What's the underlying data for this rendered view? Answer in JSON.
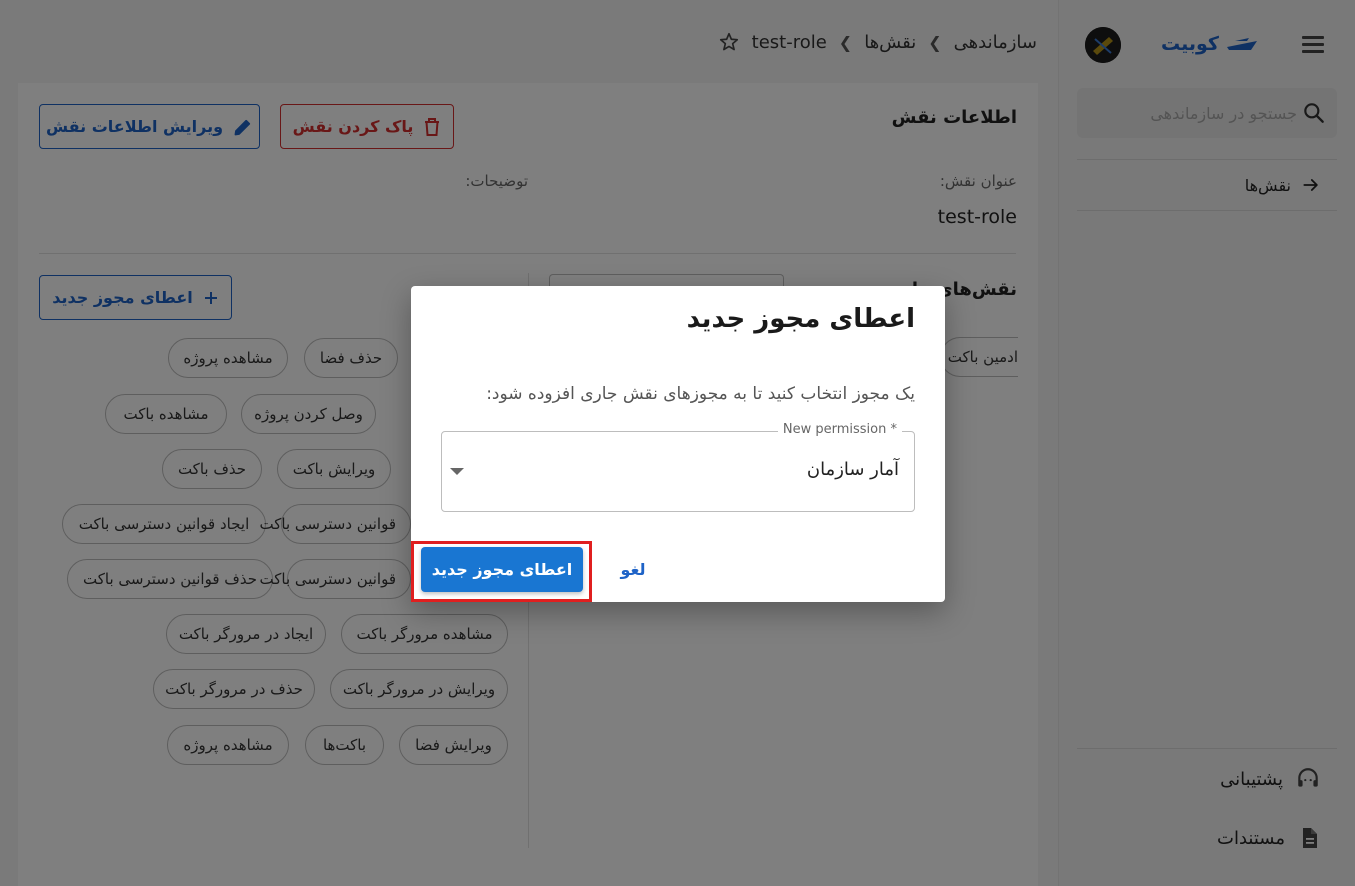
{
  "brand": {
    "name": "کوبیت"
  },
  "search": {
    "placeholder": "جستجو در سازماندهی"
  },
  "sidebar": {
    "nav": [
      {
        "label": "نقش‌ها"
      }
    ],
    "footer": [
      {
        "label": "پشتیبانی",
        "icon": "support-agent-icon"
      },
      {
        "label": "مستندات",
        "icon": "document-icon"
      }
    ]
  },
  "breadcrumb": {
    "items": [
      "سازماندهی",
      "نقش‌ها",
      "test-role"
    ]
  },
  "role_info": {
    "section_title": "اطلاعات نقش",
    "delete_label": "پاک کردن نقش",
    "edit_label": "ویرایش اطلاعات نقش",
    "title_label": "عنوان نقش:",
    "title_value": "test-role",
    "description_label": "توضیحات:"
  },
  "permissions": {
    "section_title_partial": "نقش‌های ما",
    "add_label": "اعطای مجوز جدید",
    "right_chip_partial": "ادمین باکت",
    "chips": [
      "مشاهده پروژه",
      "حذف فضا",
      "مشاهده باکت",
      "وصل کردن پروژه",
      "حذف باکت",
      "ویرایش باکت",
      "ایجاد قوانین دسترسی باکت",
      "قوانین دسترسی باکت",
      "حذف قوانین دسترسی باکت",
      "قوانین دسترسی باکت",
      "ایجاد در مرورگر باکت",
      "مشاهده مرورگر باکت",
      "حذف در مرورگر باکت",
      "ویرایش در مرورگر باکت",
      "مشاهده پروژه",
      "باکت‌ها",
      "ویرایش فضا"
    ]
  },
  "dialog": {
    "title": "اعطای مجوز جدید",
    "description": "یک مجوز انتخاب کنید تا به مجوزهای نقش جاری افزوده شود:",
    "select_label": "New permission *",
    "select_value": "آمار سازمان",
    "cancel_label": "لغو",
    "confirm_label": "اعطای مجوز جدید"
  },
  "colors": {
    "primary": "#1976d2",
    "brand": "#1e63c7",
    "danger": "#d32f2f",
    "highlight": "#e01f1f"
  }
}
